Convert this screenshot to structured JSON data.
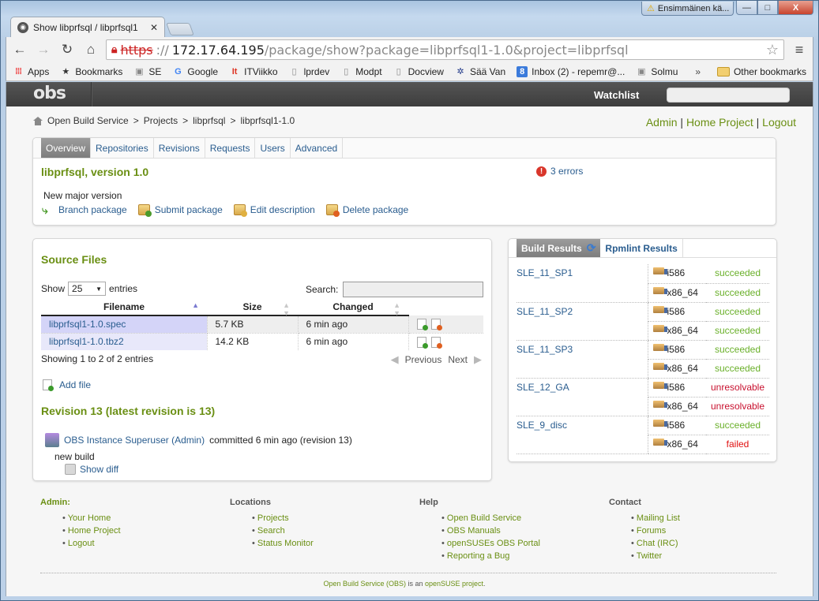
{
  "window": {
    "notification": "Ensimmäinen kä...",
    "controls": {
      "minimize": "—",
      "maximize": "□",
      "close": "X"
    }
  },
  "browser": {
    "tab_title": "Show libprfsql / libprfsql1",
    "url_scheme": "https",
    "url_host": "172.17.64.195",
    "url_rest": "/package/show?package=libprfsql1-1.0&project=libprfsql",
    "bookmarks": [
      {
        "label": "Apps",
        "icon": "apps-grid-icon"
      },
      {
        "label": "Bookmarks",
        "icon": "star-icon"
      },
      {
        "label": "SE",
        "icon": "site-icon"
      },
      {
        "label": "Google",
        "icon": "google-icon"
      },
      {
        "label": "ITViikko",
        "icon": "itviikko-icon"
      },
      {
        "label": "lprdev",
        "icon": "page-icon"
      },
      {
        "label": "Modpt",
        "icon": "page-icon"
      },
      {
        "label": "Docview",
        "icon": "page-icon"
      },
      {
        "label": "Sää Van",
        "icon": "weather-icon"
      },
      {
        "label": "Inbox (2) - repemr@...",
        "icon": "gmail-icon"
      },
      {
        "label": "Solmu",
        "icon": "site-icon"
      }
    ],
    "more_bookmarks": "»",
    "other_bookmarks": "Other bookmarks"
  },
  "header": {
    "logo": "obs",
    "watchlist": "Watchlist",
    "search_value": ""
  },
  "breadcrumb": [
    "Open Build Service",
    "Projects",
    "libprfsql",
    "libprfsql1-1.0"
  ],
  "breadcrumb_sep": ">",
  "user_links": [
    "Admin",
    "Home Project",
    "Logout"
  ],
  "user_links_sep": "|",
  "package": {
    "tabs": [
      "Overview",
      "Repositories",
      "Revisions",
      "Requests",
      "Users",
      "Advanced"
    ],
    "active_tab": "Overview",
    "title": "libprfsql, version 1.0",
    "errors": "3 errors",
    "description": "New major version",
    "actions": [
      "Branch package",
      "Submit package",
      "Edit description",
      "Delete package"
    ]
  },
  "source_files": {
    "heading": "Source Files",
    "show_label": "Show",
    "entries_value": "25",
    "entries_label": "entries",
    "search_label": "Search:",
    "search_value": "",
    "columns": [
      "Filename",
      "Size",
      "Changed"
    ],
    "rows": [
      {
        "filename": "libprfsql1-1.0.spec",
        "size": "5.7 KB",
        "changed": "6 min ago"
      },
      {
        "filename": "libprfsql1-1.0.tbz2",
        "size": "14.2 KB",
        "changed": "6 min ago"
      }
    ],
    "showing": "Showing 1 to 2 of 2 entries",
    "previous": "Previous",
    "next": "Next",
    "add_file": "Add file"
  },
  "revision": {
    "heading": "Revision 13 (latest revision is 13)",
    "author": "OBS Instance Superuser (Admin)",
    "committed": "committed 6 min ago (revision 13)",
    "message": "new build",
    "show_diff": "Show diff"
  },
  "build_results": {
    "tabs": [
      "Build Results",
      "Rpmlint Results"
    ],
    "colors": {
      "succeeded": "#6ab02a",
      "unresolvable": "#c8102e",
      "failed": "#e01010"
    },
    "repos": [
      {
        "name": "SLE_11_SP1",
        "archs": [
          {
            "arch": "i586",
            "status": "succeeded"
          },
          {
            "arch": "x86_64",
            "status": "succeeded"
          }
        ]
      },
      {
        "name": "SLE_11_SP2",
        "archs": [
          {
            "arch": "i586",
            "status": "succeeded"
          },
          {
            "arch": "x86_64",
            "status": "succeeded"
          }
        ]
      },
      {
        "name": "SLE_11_SP3",
        "archs": [
          {
            "arch": "i586",
            "status": "succeeded"
          },
          {
            "arch": "x86_64",
            "status": "succeeded"
          }
        ]
      },
      {
        "name": "SLE_12_GA",
        "archs": [
          {
            "arch": "i586",
            "status": "unresolvable"
          },
          {
            "arch": "x86_64",
            "status": "unresolvable"
          }
        ]
      },
      {
        "name": "SLE_9_disc",
        "archs": [
          {
            "arch": "i586",
            "status": "succeeded"
          },
          {
            "arch": "x86_64",
            "status": "failed"
          }
        ]
      }
    ]
  },
  "footer": {
    "columns": [
      {
        "heading": "Admin:",
        "links": [
          "Your Home",
          "Home Project",
          "Logout"
        ]
      },
      {
        "heading": "Locations",
        "links": [
          "Projects",
          "Search",
          "Status Monitor"
        ]
      },
      {
        "heading": "Help",
        "links": [
          "Open Build Service",
          "OBS Manuals",
          "openSUSEs OBS Portal",
          "Reporting a Bug"
        ]
      },
      {
        "heading": "Contact",
        "links": [
          "Mailing List",
          "Forums",
          "Chat (IRC)",
          "Twitter"
        ]
      }
    ],
    "note_link1": "Open Build Service (OBS)",
    "note_mid": " is an ",
    "note_link2": "openSUSE project",
    "note_end": "."
  }
}
